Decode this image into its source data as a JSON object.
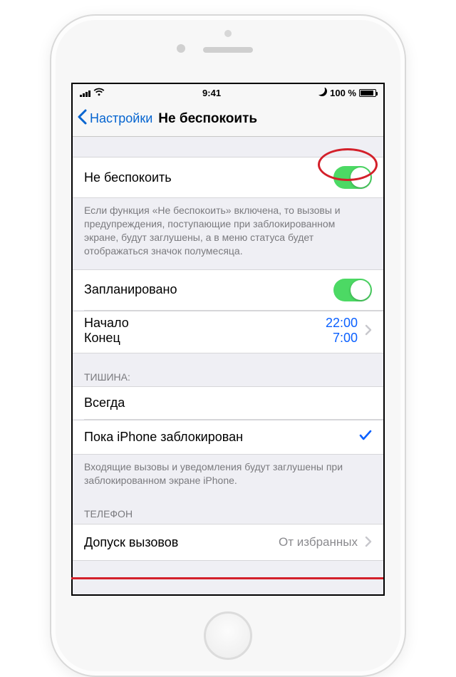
{
  "status": {
    "time": "9:41",
    "battery_text": "100 %"
  },
  "nav": {
    "back": "Настройки",
    "title": "Не беспокоить"
  },
  "dnd": {
    "label": "Не беспокоить",
    "footer": "Если функция «Не беспокоить» включена, то вызовы и предупреждения, поступающие при заблокированном экране, будут заглушены, а в меню статуса будет отображаться значок полумесяца."
  },
  "scheduled": {
    "label": "Запланировано",
    "from_label": "Начало",
    "from_value": "22:00",
    "to_label": "Конец",
    "to_value": "7:00"
  },
  "silence": {
    "header": "ТИШИНА:",
    "always": "Всегда",
    "locked": "Пока iPhone заблокирован",
    "footer": "Входящие вызовы и уведомления будут заглушены при заблокированном экране iPhone."
  },
  "phone": {
    "header": "ТЕЛЕФОН",
    "allow_label": "Допуск вызовов",
    "allow_value": "От избранных"
  }
}
